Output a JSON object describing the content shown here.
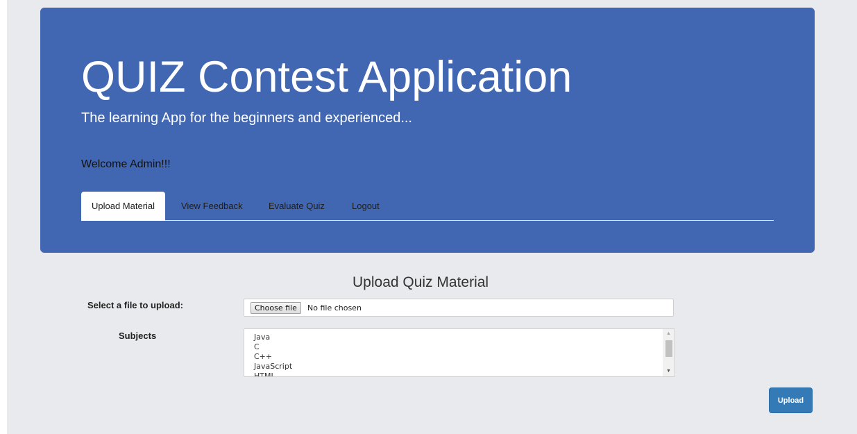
{
  "header": {
    "title": "QUIZ Contest Application",
    "subtitle": "The learning App for the beginners and experienced...",
    "welcome": "Welcome Admin!!!"
  },
  "nav": {
    "tabs": [
      {
        "label": "Upload Material",
        "active": true
      },
      {
        "label": "View Feedback",
        "active": false
      },
      {
        "label": "Evaluate Quiz",
        "active": false
      },
      {
        "label": "Logout",
        "active": false
      }
    ]
  },
  "form": {
    "heading": "Upload Quiz Material",
    "file_label": "Select a file to upload:",
    "choose_file_label": "Choose file",
    "no_file_text": "No file chosen",
    "subjects_label": "Subjects",
    "subjects": [
      "Java",
      "C",
      "C++",
      "JavaScript",
      "HTML"
    ],
    "upload_label": "Upload"
  },
  "colors": {
    "header_bg": "#4267b2",
    "page_bg": "#e9eaed",
    "button_primary": "#337ab7"
  },
  "icons": {
    "scroll_up": "triangle-up-icon",
    "scroll_down": "triangle-down-icon"
  }
}
